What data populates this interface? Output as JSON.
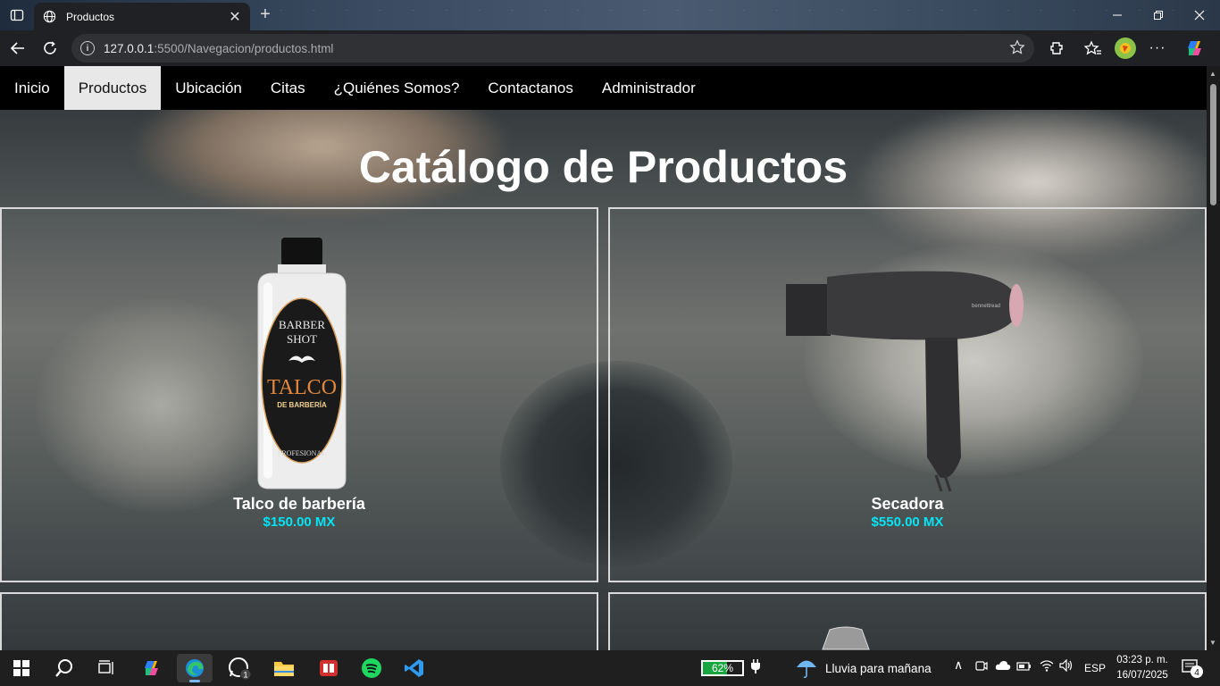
{
  "browser": {
    "tab_title": "Productos",
    "url_host": "127.0.0.1",
    "url_rest": ":5500/Navegacion/productos.html"
  },
  "site": {
    "nav": [
      "Inicio",
      "Productos",
      "Ubicación",
      "Citas",
      "¿Quiénes Somos?",
      "Contactanos",
      "Administrador"
    ],
    "active_nav": "Productos",
    "title": "Catálogo de Productos",
    "products": [
      {
        "name": "Talco de barbería",
        "price": "$150.00 MX",
        "label": {
          "line1": "BARBER",
          "line2": "SHOT",
          "line3": "TALCO",
          "line4": "DE BARBERÍA",
          "line5": "PROFESIONAL"
        }
      },
      {
        "name": "Secadora",
        "price": "$550.00 MX",
        "label": {
          "brand": "bennettread"
        }
      }
    ],
    "accent_price_color": "#00e5f5"
  },
  "taskbar": {
    "battery_percent": 62,
    "battery_label": "62%",
    "weather": "Lluvia para mañana",
    "language": "ESP",
    "time": "03:23 p. m.",
    "date": "16/07/2025",
    "notifications": "4",
    "whatsapp_badge": "1"
  }
}
